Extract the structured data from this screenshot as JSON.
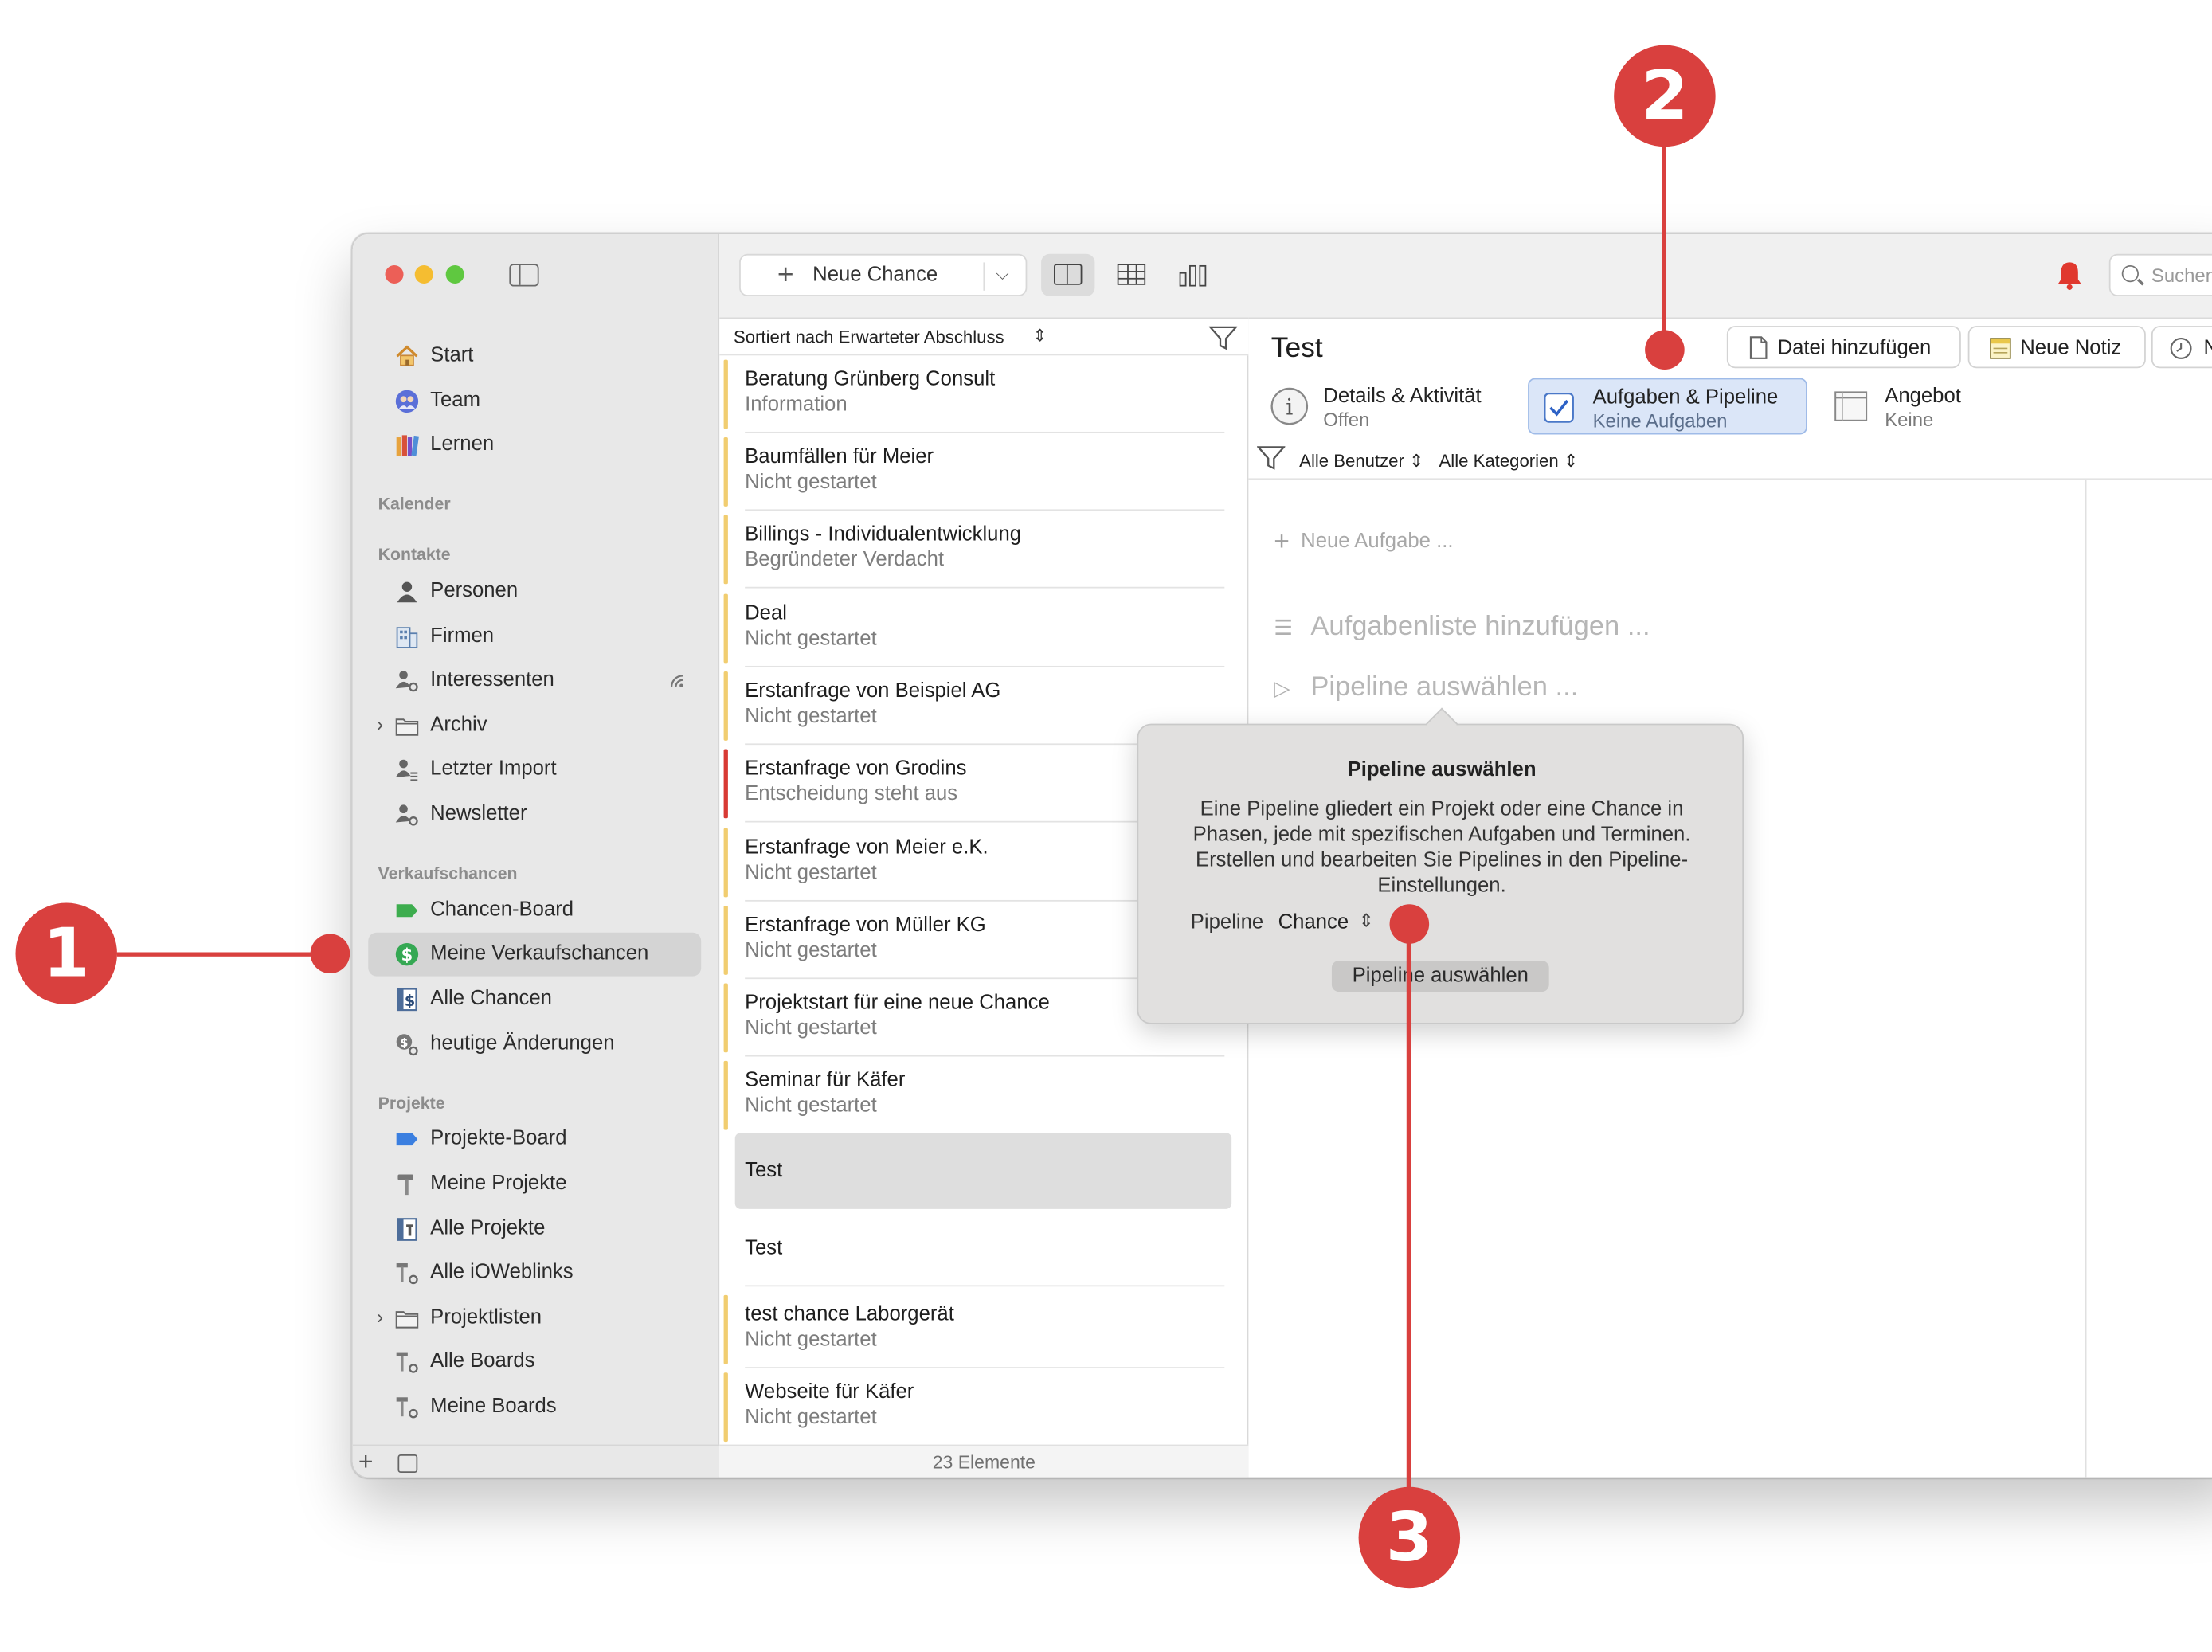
{
  "sidebar": {
    "nav": [
      {
        "label": "Start"
      },
      {
        "label": "Team"
      },
      {
        "label": "Lernen"
      }
    ],
    "sections": {
      "calendar": "Kalender",
      "contacts": "Kontakte",
      "opportunities": "Verkaufschancen",
      "projects": "Projekte"
    },
    "contacts": [
      {
        "label": "Personen"
      },
      {
        "label": "Firmen"
      },
      {
        "label": "Interessenten"
      },
      {
        "label": "Archiv"
      },
      {
        "label": "Letzter Import"
      },
      {
        "label": "Newsletter"
      }
    ],
    "opportunities": [
      {
        "label": "Chancen-Board"
      },
      {
        "label": "Meine Verkaufschancen",
        "selected": true
      },
      {
        "label": "Alle Chancen"
      },
      {
        "label": "heutige Änderungen"
      }
    ],
    "projects": [
      {
        "label": "Projekte-Board"
      },
      {
        "label": "Meine Projekte"
      },
      {
        "label": "Alle Projekte"
      },
      {
        "label": "Alle iOWeblinks"
      },
      {
        "label": "Projektlisten"
      },
      {
        "label": "Alle Boards"
      },
      {
        "label": "Meine Boards"
      }
    ]
  },
  "list": {
    "new_button_label": "Neue Chance",
    "sort_label": "Sortiert nach Erwarteter Abschluss",
    "items": [
      {
        "title": "Beratung Grünberg Consult",
        "status": "Information"
      },
      {
        "title": "Baumfällen für Meier",
        "status": "Nicht gestartet"
      },
      {
        "title": "Billings - Individualentwicklung",
        "status": "Begründeter Verdacht"
      },
      {
        "title": "Deal",
        "status": "Nicht gestartet"
      },
      {
        "title": "Erstanfrage von Beispiel AG",
        "status": "Nicht gestartet"
      },
      {
        "title": "Erstanfrage von Grodins",
        "status": "Entscheidung steht aus"
      },
      {
        "title": "Erstanfrage von Meier e.K.",
        "status": "Nicht gestartet"
      },
      {
        "title": "Erstanfrage von Müller KG",
        "status": "Nicht gestartet"
      },
      {
        "title": "Projektstart für eine neue Chance",
        "status": "Nicht gestartet"
      },
      {
        "title": "Seminar für Käfer",
        "status": "Nicht gestartet"
      },
      {
        "title": "Test",
        "status": ""
      },
      {
        "title": "Test",
        "status": ""
      },
      {
        "title": "test chance Laborgerät",
        "status": "Nicht gestartet"
      },
      {
        "title": "Webseite für Käfer",
        "status": "Nicht gestartet"
      }
    ],
    "footer": "23 Elemente"
  },
  "detail": {
    "search_placeholder": "Suchen",
    "title": "Test",
    "actions": {
      "add_file": "Datei hinzufügen",
      "new_note": "Neue Notiz",
      "truncated": "N"
    },
    "tabs": [
      {
        "label": "Details & Aktivität",
        "sub": "Offen"
      },
      {
        "label": "Aufgaben & Pipeline",
        "sub": "Keine Aufgaben",
        "active": true
      },
      {
        "label": "Angebot",
        "sub": "Keine"
      }
    ],
    "filters": {
      "users": "Alle Benutzer",
      "categories": "Alle Kategorien"
    },
    "new_task": "Neue Aufgabe ...",
    "add_tasklist": "Aufgabenliste hinzufügen ...",
    "choose_pipeline": "Pipeline auswählen ..."
  },
  "popover": {
    "title": "Pipeline auswählen",
    "description": "Eine Pipeline gliedert ein Projekt oder eine Chance in Phasen, jede mit spezifischen Aufgaben und Terminen. Erstellen und bearbeiten Sie Pipelines in den Pipeline-Einstellungen.",
    "pipeline_label": "Pipeline",
    "pipeline_value": "Chance",
    "button": "Pipeline auswählen"
  },
  "callouts": [
    "1",
    "2",
    "3"
  ],
  "colors": {
    "callout": "#d9403e",
    "status_bar_default": "#f1cd70",
    "status_bar_alert": "#d83a34",
    "active_tab": "#dbe6f8",
    "bell": "#e0382e"
  }
}
